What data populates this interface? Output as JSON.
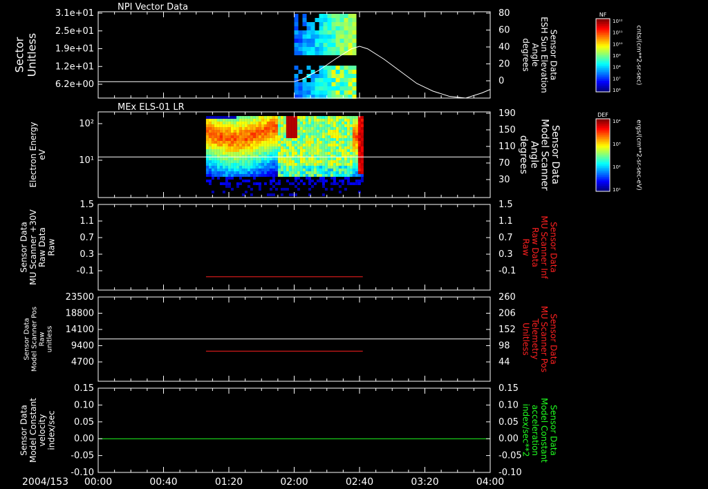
{
  "time_axis": {
    "date": "2004/153",
    "tick_labels": [
      "00:00",
      "00:40",
      "01:20",
      "02:00",
      "02:40",
      "03:20",
      "04:00"
    ],
    "range_minutes": [
      0,
      240
    ]
  },
  "colorbars": [
    {
      "title": "NF",
      "tick_labels": [
        "10¹²",
        "10¹¹",
        "10¹⁰",
        "10⁹",
        "10⁸",
        "10⁷",
        "10⁶"
      ],
      "unit_label": "cnts/(cm**2-sr-sec)"
    },
    {
      "title": "DEF",
      "tick_labels": [
        "10⁴",
        "10³",
        "10²",
        "10¹"
      ],
      "unit_label": "ergs/(cm**2-sr-sec-eV)"
    }
  ],
  "chart_data": [
    {
      "type": "heatmap",
      "title": "NPI Vector Data",
      "ylabel": "Sector\nUnitless",
      "y_tick_labels": [
        "3.1e+01",
        "2.5e+01",
        "1.9e+01",
        "1.2e+01",
        "6.2e+00"
      ],
      "right_ylabel": "Sensor Data\nESH Sun Elevation\nAngle\ndegrees",
      "right_ylim": [
        -20,
        80
      ],
      "right_y_tick_labels": [
        "80",
        "60",
        "40",
        "20",
        "0"
      ],
      "overlay_line": {
        "name": "ESH Sun Elevation Angle",
        "color": "#ffffff",
        "x_minutes": [
          0,
          120,
          125,
          135,
          145,
          155,
          160,
          165,
          175,
          185,
          195,
          205,
          215,
          225,
          235,
          240
        ],
        "y": [
          -1,
          -1,
          2,
          12,
          25,
          37,
          40,
          37,
          25,
          11,
          -3,
          -12,
          -18,
          -20,
          -14,
          -10
        ]
      },
      "data_extent_minutes": [
        120,
        158
      ]
    },
    {
      "type": "heatmap",
      "title": "MEx ELS-01 LR",
      "ylabel": "Electron Energy\neV",
      "y_scale": "log",
      "ylim": [
        1,
        200
      ],
      "y_tick_labels": [
        "10²",
        "10¹"
      ],
      "right_ylabel": "Sensor Data\nModel Scanner\nAngle\ndegrees",
      "right_ylim": [
        0,
        190
      ],
      "right_y_tick_labels": [
        "190",
        "150",
        "110",
        "70",
        "30"
      ],
      "overlay_line": {
        "name": "Model Scanner Angle",
        "color": "#ffffff",
        "x_minutes": [
          0,
          240
        ],
        "y": [
          90,
          90
        ]
      },
      "data_extent_minutes": [
        66,
        162
      ]
    },
    {
      "type": "line",
      "ylabel": "Sensor Data\nMU Scanner +30V\nRaw Data\nRaw",
      "ylim": [
        -0.3,
        1.5
      ],
      "y_tick_labels": [
        "1.5",
        "1.1",
        "0.7",
        "0.3",
        "-0.1"
      ],
      "right_ylabel": "Sensor Data\nMU Scanner Inf\nRaw Data\nRaw",
      "right_ylim": [
        -0.3,
        1.5
      ],
      "right_y_tick_labels": [
        "1.5",
        "1.1",
        "0.7",
        "0.3",
        "-0.1"
      ],
      "series": [
        {
          "name": "MU Scanner Inf Raw Data",
          "color": "#ff2020",
          "x_minutes": [
            66,
            162
          ],
          "y": [
            -0.02,
            -0.02
          ]
        }
      ]
    },
    {
      "type": "line",
      "ylabel": "Sensor Data\nModel Scanner Pos\nRaw\nunitless",
      "ylim": [
        0,
        23500
      ],
      "y_tick_labels": [
        "23500",
        "18800",
        "14100",
        "9400",
        "4700"
      ],
      "right_ylabel": "Sensor Data\nMU Scanner Pos\nTelemetry\nUnitless",
      "right_ylim": [
        0,
        260
      ],
      "right_y_tick_labels": [
        "260",
        "206",
        "152",
        "98",
        "44"
      ],
      "series": [
        {
          "name": "Model Scanner Pos Raw",
          "color": "#ffffff",
          "axis": "left",
          "x_minutes": [
            0,
            240
          ],
          "y": [
            11800,
            11800
          ]
        },
        {
          "name": "MU Scanner Pos Telemetry",
          "color": "#ff2020",
          "axis": "right",
          "x_minutes": [
            66,
            162
          ],
          "y": [
            93,
            93
          ]
        }
      ]
    },
    {
      "type": "line",
      "ylabel": "Sensor Data\nModel Constant\nvelocity\nindex/sec",
      "ylim": [
        -0.1,
        0.15
      ],
      "y_tick_labels": [
        "0.15",
        "0.10",
        "0.05",
        "0.00",
        "-0.05",
        "-0.10"
      ],
      "right_ylabel": "Sensor Data\nModel Constant\nacceleration\nindex/sec**2",
      "right_ylim": [
        -0.1,
        0.15
      ],
      "right_y_tick_labels": [
        "0.15",
        "0.10",
        "0.05",
        "0.00",
        "-0.05",
        "-0.10"
      ],
      "series": [
        {
          "name": "Model Constant acceleration",
          "color": "#20ff20",
          "x_minutes": [
            0,
            240
          ],
          "y": [
            0.0,
            0.0
          ]
        }
      ]
    }
  ]
}
